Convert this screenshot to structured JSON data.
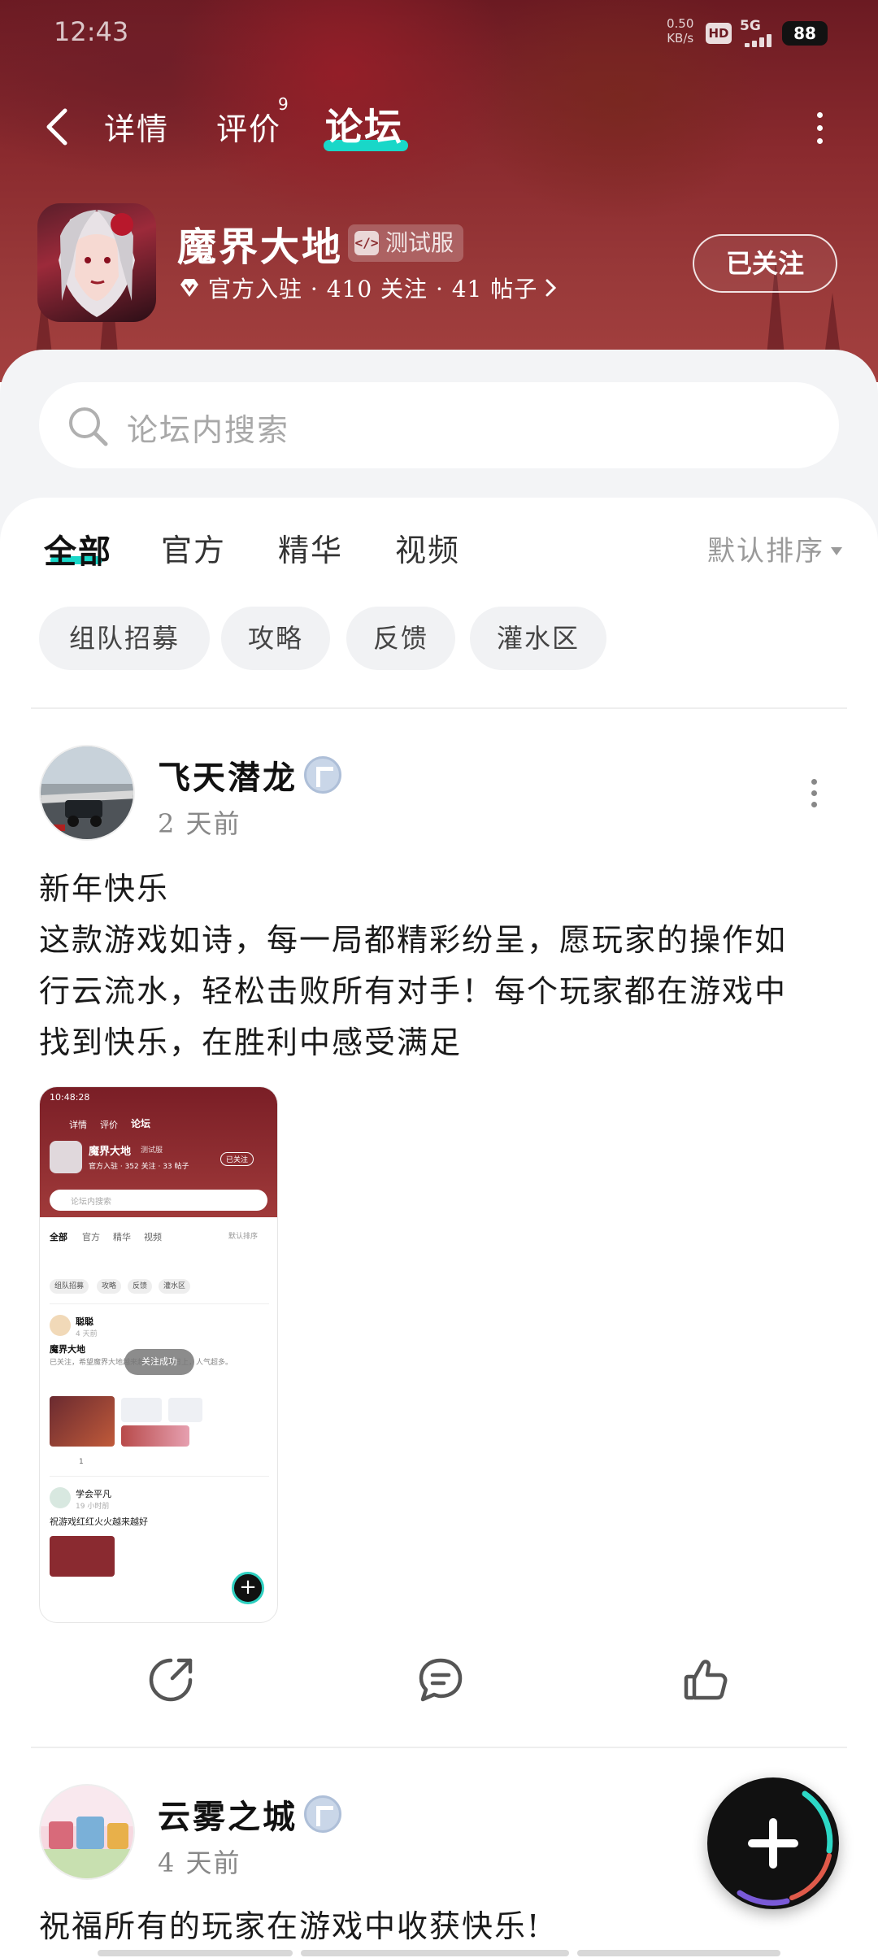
{
  "status_bar": {
    "time": "12:43",
    "net_speed_value": "0.50",
    "net_speed_unit": "KB/s",
    "hd": "HD",
    "network": "5G",
    "battery": "88"
  },
  "nav": {
    "tabs": [
      {
        "label": "详情"
      },
      {
        "label": "评价",
        "badge": "9"
      },
      {
        "label": "论坛"
      }
    ],
    "active_tab": "论坛"
  },
  "game": {
    "title": "魔界大地",
    "badge": "测试服",
    "badge_icon": "</>",
    "meta": "官方入驻 · 410 关注 · 41 帖子",
    "follow_label": "已关注"
  },
  "search": {
    "placeholder": "论坛内搜索"
  },
  "categories": {
    "tabs": [
      "全部",
      "官方",
      "精华",
      "视频"
    ],
    "active": "全部",
    "sort_label": "默认排序",
    "chips": [
      "组队招募",
      "攻略",
      "反馈",
      "灌水区"
    ]
  },
  "posts": [
    {
      "author": "飞天潜龙",
      "time": "2 天前",
      "lines": [
        "新年快乐",
        "这款游戏如诗，每一局都精彩纷呈，愿玩家的操作如",
        "行云流水，轻松击败所有对手！每个玩家都在游戏中",
        "找到快乐，在胜利中感受满足"
      ],
      "screenshot": {
        "time": "10:48:28",
        "tabs": [
          "详情",
          "评价",
          "论坛"
        ],
        "title": "魔界大地",
        "badge": "测试服",
        "meta": "官方入驻 · 352 关注 · 33 帖子",
        "follow": "已关注",
        "search": "论坛内搜索",
        "cats": [
          "全部",
          "官方",
          "精华",
          "视频"
        ],
        "sort": "默认排序",
        "chips": [
          "组队招募",
          "攻略",
          "反馈",
          "灌水区"
        ],
        "post1_author": "聪聪",
        "post1_time": "4 天前",
        "post1_title": "魔界大地",
        "post1_text": "已关注，希望魔界大地越来越好，慕名日上，人气超多。",
        "toast": "关注成功",
        "post1_count": "1",
        "post2_author": "学会平凡",
        "post2_time": "19 小时前",
        "post2_text": "祝游戏红红火火越来越好"
      }
    },
    {
      "author": "云雾之城",
      "time": "4 天前",
      "lines": [
        "祝福所有的玩家在游戏中收获快乐!"
      ]
    }
  ],
  "colors": {
    "accent": "#19d7c8",
    "hero": "#8a2a2e"
  }
}
